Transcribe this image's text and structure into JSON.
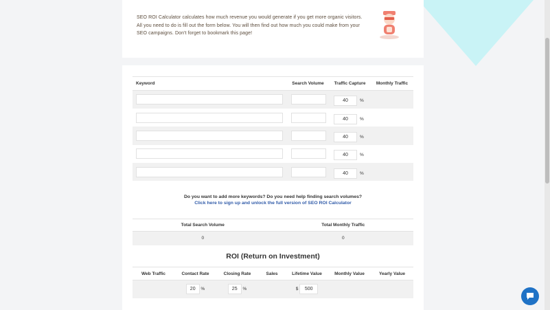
{
  "intro": {
    "text_part1": "SEO ROI Calculator calculates how much revenue you would generate if you get more organic visitors. All you need to do is fill out the form below. You will then find out how much you could make from your SEO campaigns. Don't forget to bookmark this page!"
  },
  "keywords_table": {
    "headers": [
      "Keyword",
      "Search Volume",
      "Traffic Capture",
      "Monthly Traffic"
    ],
    "rows": [
      {
        "keyword": "",
        "search_volume": "",
        "traffic_capture": "40",
        "unit": "%",
        "monthly_traffic": ""
      },
      {
        "keyword": "",
        "search_volume": "",
        "traffic_capture": "40",
        "unit": "%",
        "monthly_traffic": ""
      },
      {
        "keyword": "",
        "search_volume": "",
        "traffic_capture": "40",
        "unit": "%",
        "monthly_traffic": ""
      },
      {
        "keyword": "",
        "search_volume": "",
        "traffic_capture": "40",
        "unit": "%",
        "monthly_traffic": ""
      },
      {
        "keyword": "",
        "search_volume": "",
        "traffic_capture": "40",
        "unit": "%",
        "monthly_traffic": ""
      }
    ]
  },
  "promo": {
    "question": "Do you want to add more keywords? Do you need help finding search volumes?",
    "link": "Click here to sign up and unlock the full version of SEO ROI Calculator"
  },
  "totals": {
    "headers": [
      "Total Search Volume",
      "Total Monthly Traffic"
    ],
    "values": [
      "0",
      "0"
    ]
  },
  "roi": {
    "title": "ROI (Return on Investment)",
    "headers": [
      "Web Traffic",
      "Contact Rate",
      "Closing Rate",
      "Sales",
      "Lifetime Value",
      "Monthly Value",
      "Yearly Value"
    ],
    "contact_rate": "20",
    "closing_rate": "25",
    "percent": "%",
    "currency": "$",
    "lifetime_value": "500"
  },
  "colors": {
    "accent_link": "#2f5aa8",
    "bg_teal": "#c9f3f6",
    "chat_button": "#1f72c6"
  },
  "icons": {
    "mascot": "mascot-icon",
    "chat": "chat-bubble-icon"
  }
}
